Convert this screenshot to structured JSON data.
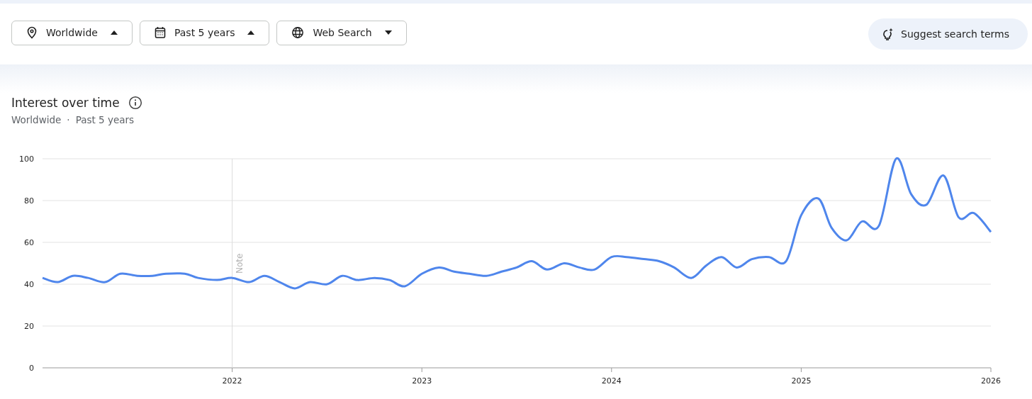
{
  "filters": [
    {
      "label": "Worldwide",
      "expanded": true
    },
    {
      "label": "Past 5 years",
      "expanded": true
    },
    {
      "label": "Web Search",
      "expanded": false
    }
  ],
  "suggest_button": {
    "label": "Suggest search terms"
  },
  "section": {
    "title": "Interest over time",
    "subtitle": [
      "Worldwide",
      "·",
      "Past 5 years"
    ],
    "chart_data": {
      "type": "line",
      "xlim": [
        2021,
        2026
      ],
      "ylim": [
        0,
        100
      ],
      "xticks": [
        {
          "value": 2022,
          "label": "2022"
        },
        {
          "value": 2023,
          "label": "2023"
        },
        {
          "value": 2024,
          "label": "2024"
        },
        {
          "value": 2025,
          "label": "2025"
        },
        {
          "value": 2026,
          "label": "2026"
        }
      ],
      "yticks": [
        0,
        20,
        40,
        60,
        80,
        100
      ],
      "grid": true,
      "ref_lines": [
        {
          "axis": "x",
          "value": 2022,
          "label": "Note"
        }
      ],
      "x": [
        2021.0,
        2021.08,
        2021.16,
        2021.24,
        2021.33,
        2021.41,
        2021.5,
        2021.58,
        2021.65,
        2021.75,
        2021.82,
        2021.92,
        2022.0,
        2022.09,
        2022.17,
        2022.25,
        2022.33,
        2022.41,
        2022.5,
        2022.58,
        2022.66,
        2022.75,
        2022.83,
        2022.91,
        2023.0,
        2023.09,
        2023.17,
        2023.25,
        2023.34,
        2023.42,
        2023.5,
        2023.58,
        2023.66,
        2023.75,
        2023.83,
        2023.91,
        2024.0,
        2024.08,
        2024.17,
        2024.25,
        2024.33,
        2024.42,
        2024.5,
        2024.58,
        2024.66,
        2024.74,
        2024.83,
        2024.92,
        2025.0,
        2025.09,
        2025.16,
        2025.24,
        2025.32,
        2025.41,
        2025.5,
        2025.58,
        2025.66,
        2025.75,
        2025.83,
        2025.91,
        2026.0
      ],
      "series": [
        {
          "color": "#4f86ec",
          "values": [
            43,
            41,
            44,
            43,
            41,
            45,
            44,
            44,
            45,
            45,
            43,
            42,
            43,
            41,
            44,
            41,
            38,
            41,
            40,
            44,
            42,
            43,
            42,
            39,
            45,
            48,
            46,
            45,
            44,
            46,
            48,
            51,
            47,
            50,
            48,
            47,
            53,
            53,
            52,
            51,
            48,
            43,
            49,
            53,
            48,
            52,
            53,
            51,
            73,
            81,
            67,
            61,
            70,
            68,
            100,
            83,
            78,
            92,
            72,
            74,
            65
          ]
        }
      ]
    }
  }
}
